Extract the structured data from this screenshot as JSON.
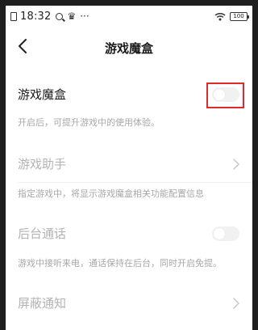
{
  "status_bar": {
    "time": "18:32",
    "battery": "100"
  },
  "header": {
    "title": "游戏魔盒"
  },
  "settings": {
    "game_box": {
      "label": "游戏魔盒",
      "description": "开启后，可提升游戏中的使用体验。",
      "toggle_on": false
    },
    "game_assistant": {
      "label": "游戏助手",
      "description": "指定游戏中，将显示游戏魔盒相关功能配置信息"
    },
    "background_call": {
      "label": "后台通话",
      "description": "游戏中接听来电，通话保持在后台，同时开启免提。",
      "toggle_on": false
    },
    "block_notifications": {
      "label": "屏蔽通知"
    }
  },
  "colors": {
    "highlight": "#e0282f",
    "disabled_text": "#b3b3b3",
    "description_text": "#a8a8a8"
  }
}
